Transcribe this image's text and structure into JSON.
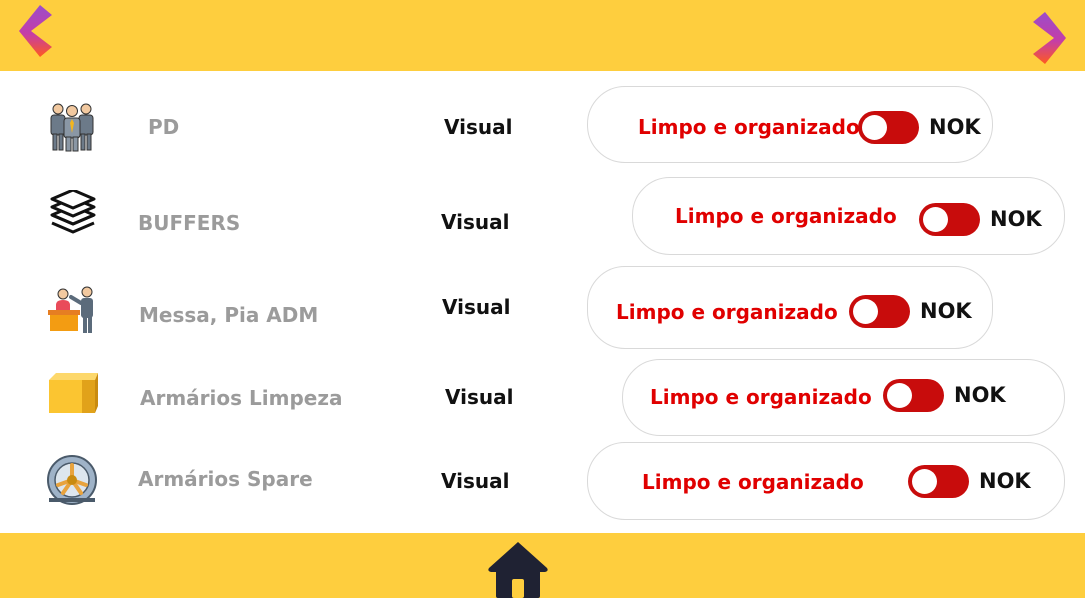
{
  "header": {
    "prev_icon": "chevron-left-icon",
    "next_icon": "chevron-right-icon"
  },
  "footer": {
    "home_icon": "home-icon"
  },
  "colors": {
    "bar": "#FECE3E",
    "criterion_text": "#E00000",
    "toggle_off": "#C80C0C",
    "name_text": "#9B9B9B"
  },
  "rows": [
    {
      "icon": "people-group-icon",
      "name": "PD",
      "method": "Visual",
      "criterion": "Limpo e organizado",
      "status": "NOK",
      "toggle_on": false
    },
    {
      "icon": "layers-icon",
      "name": "BUFFERS",
      "method": "Visual",
      "criterion": "Limpo e organizado",
      "status": "NOK",
      "toggle_on": false
    },
    {
      "icon": "reception-desk-icon",
      "name": "Messa, Pia ADM",
      "method": "Visual",
      "criterion": "Limpo e organizado",
      "status": "NOK",
      "toggle_on": false
    },
    {
      "icon": "box-icon",
      "name": "Armários Limpeza",
      "method": "Visual",
      "criterion": "Limpo e organizado",
      "status": "NOK",
      "toggle_on": false
    },
    {
      "icon": "wheel-icon",
      "name": "Armários Spare",
      "method": "Visual",
      "criterion": "Limpo e organizado",
      "status": "NOK",
      "toggle_on": false
    }
  ]
}
